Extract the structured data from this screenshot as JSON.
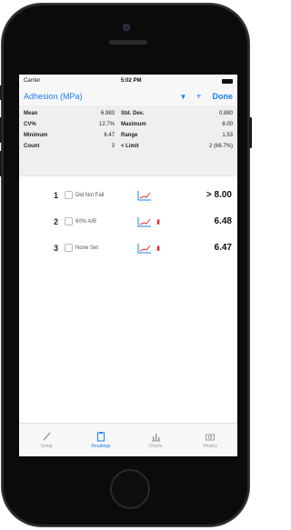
{
  "status_bar": {
    "carrier": "Carrier",
    "time": "5:02 PM"
  },
  "nav": {
    "title": "Adhesion (MPa)",
    "arrow": "▼",
    "plus": "+",
    "done": "Done"
  },
  "stats": [
    {
      "label": "Mean",
      "value": "6.983",
      "label2": "Std. Dev.",
      "value2": "0.880"
    },
    {
      "label": "CV%",
      "value": "12.7%",
      "label2": "Maximum",
      "value2": "8.00"
    },
    {
      "label": "Minimum",
      "value": "6.47",
      "label2": "Range",
      "value2": "1.53"
    },
    {
      "label": "Count",
      "value": "3",
      "label2": "< Limit",
      "value2": "2 (66.7%)"
    }
  ],
  "readings": [
    {
      "index": "1",
      "label": "Did Not Fail",
      "flag": "",
      "value": "> 8.00"
    },
    {
      "index": "2",
      "label": "60% A/B",
      "flag": "▮",
      "value": "6.48"
    },
    {
      "index": "3",
      "label": "None Set",
      "flag": "▮",
      "value": "6.47"
    }
  ],
  "tabs": [
    {
      "label": "Setup",
      "icon": "pencil-icon"
    },
    {
      "label": "Readings",
      "icon": "clipboard-icon",
      "active": true
    },
    {
      "label": "Charts",
      "icon": "bar-chart-icon"
    },
    {
      "label": "Photos",
      "icon": "camera-icon"
    }
  ],
  "colors": {
    "accent": "#1a7ff0",
    "flag": "#e03030",
    "stats_bg": "#efeff1",
    "device": "#0b0b0c"
  }
}
